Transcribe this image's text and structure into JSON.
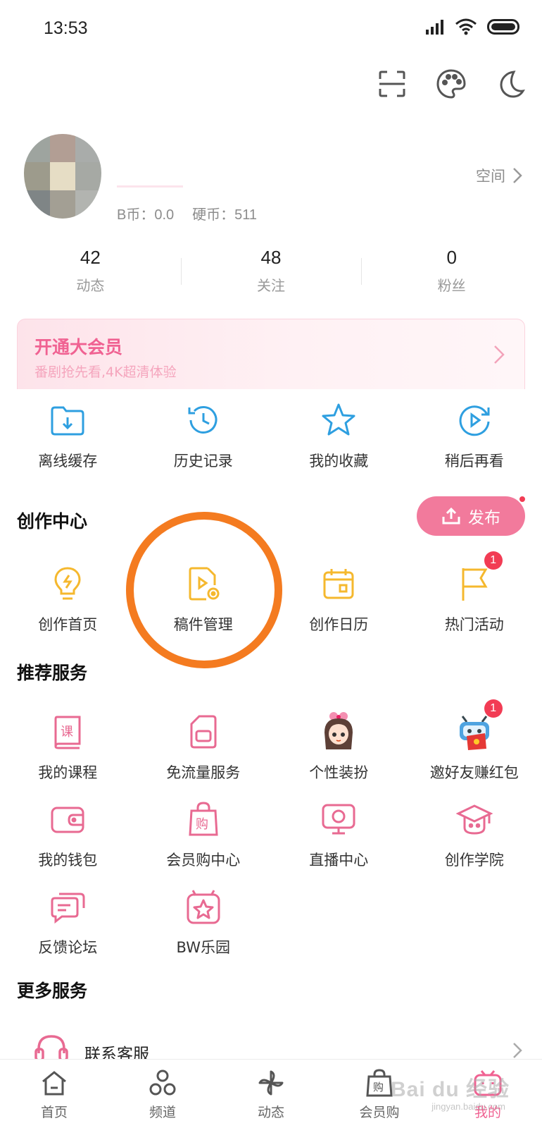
{
  "status_bar": {
    "time": "13:53"
  },
  "profile": {
    "coins_b": "B币：0.0",
    "coins_hard": "硬币：511",
    "space_label": "空间"
  },
  "stats": [
    {
      "value": "42",
      "label": "动态"
    },
    {
      "value": "48",
      "label": "关注"
    },
    {
      "value": "0",
      "label": "粉丝"
    }
  ],
  "vip": {
    "title": "开通大会员",
    "subtitle": "番剧抢先看,4K超清体验"
  },
  "quick_actions": [
    {
      "label": "离线缓存",
      "icon": "download-folder-icon"
    },
    {
      "label": "历史记录",
      "icon": "history-clock-icon"
    },
    {
      "label": "我的收藏",
      "icon": "star-icon"
    },
    {
      "label": "稍后再看",
      "icon": "watch-later-icon"
    }
  ],
  "creation_center": {
    "title": "创作中心",
    "publish_label": "发布",
    "items": [
      {
        "label": "创作首页",
        "icon": "lightbulb-icon"
      },
      {
        "label": "稿件管理",
        "icon": "video-file-icon"
      },
      {
        "label": "创作日历",
        "icon": "calendar-icon"
      },
      {
        "label": "热门活动",
        "icon": "flag-icon",
        "badge": "1"
      }
    ]
  },
  "recommended": {
    "title": "推荐服务",
    "items": [
      {
        "label": "我的课程",
        "icon": "course-book-icon"
      },
      {
        "label": "免流量服务",
        "icon": "sim-card-icon"
      },
      {
        "label": "个性装扮",
        "icon": "character-avatar-icon"
      },
      {
        "label": "邀好友赚红包",
        "icon": "robot-redpacket-icon",
        "badge": "1"
      },
      {
        "label": "我的钱包",
        "icon": "wallet-icon"
      },
      {
        "label": "会员购中心",
        "icon": "shopping-bag-icon"
      },
      {
        "label": "直播中心",
        "icon": "live-tv-icon"
      },
      {
        "label": "创作学院",
        "icon": "graduation-cap-icon"
      },
      {
        "label": "反馈论坛",
        "icon": "chat-bubbles-icon"
      },
      {
        "label": "BW乐园",
        "icon": "bw-star-icon"
      }
    ]
  },
  "more_services": {
    "title": "更多服务",
    "items": [
      {
        "label": "联系客服",
        "icon": "headset-icon"
      }
    ]
  },
  "bottom_nav": [
    {
      "label": "首页",
      "icon": "home-icon"
    },
    {
      "label": "频道",
      "icon": "channel-icon"
    },
    {
      "label": "动态",
      "icon": "pinwheel-icon"
    },
    {
      "label": "会员购",
      "icon": "bag-icon"
    },
    {
      "label": "我的",
      "icon": "tv-mascot-icon",
      "active": true
    }
  ],
  "watermark": {
    "text": "Bai du 经验",
    "sub": "jingyan.baidu.com"
  },
  "colors": {
    "accent": "#f06292",
    "icon_blue": "#2e9fe0",
    "icon_yellow": "#f5b82e",
    "icon_pink": "#e86a92",
    "highlight_orange": "#f47b20"
  }
}
